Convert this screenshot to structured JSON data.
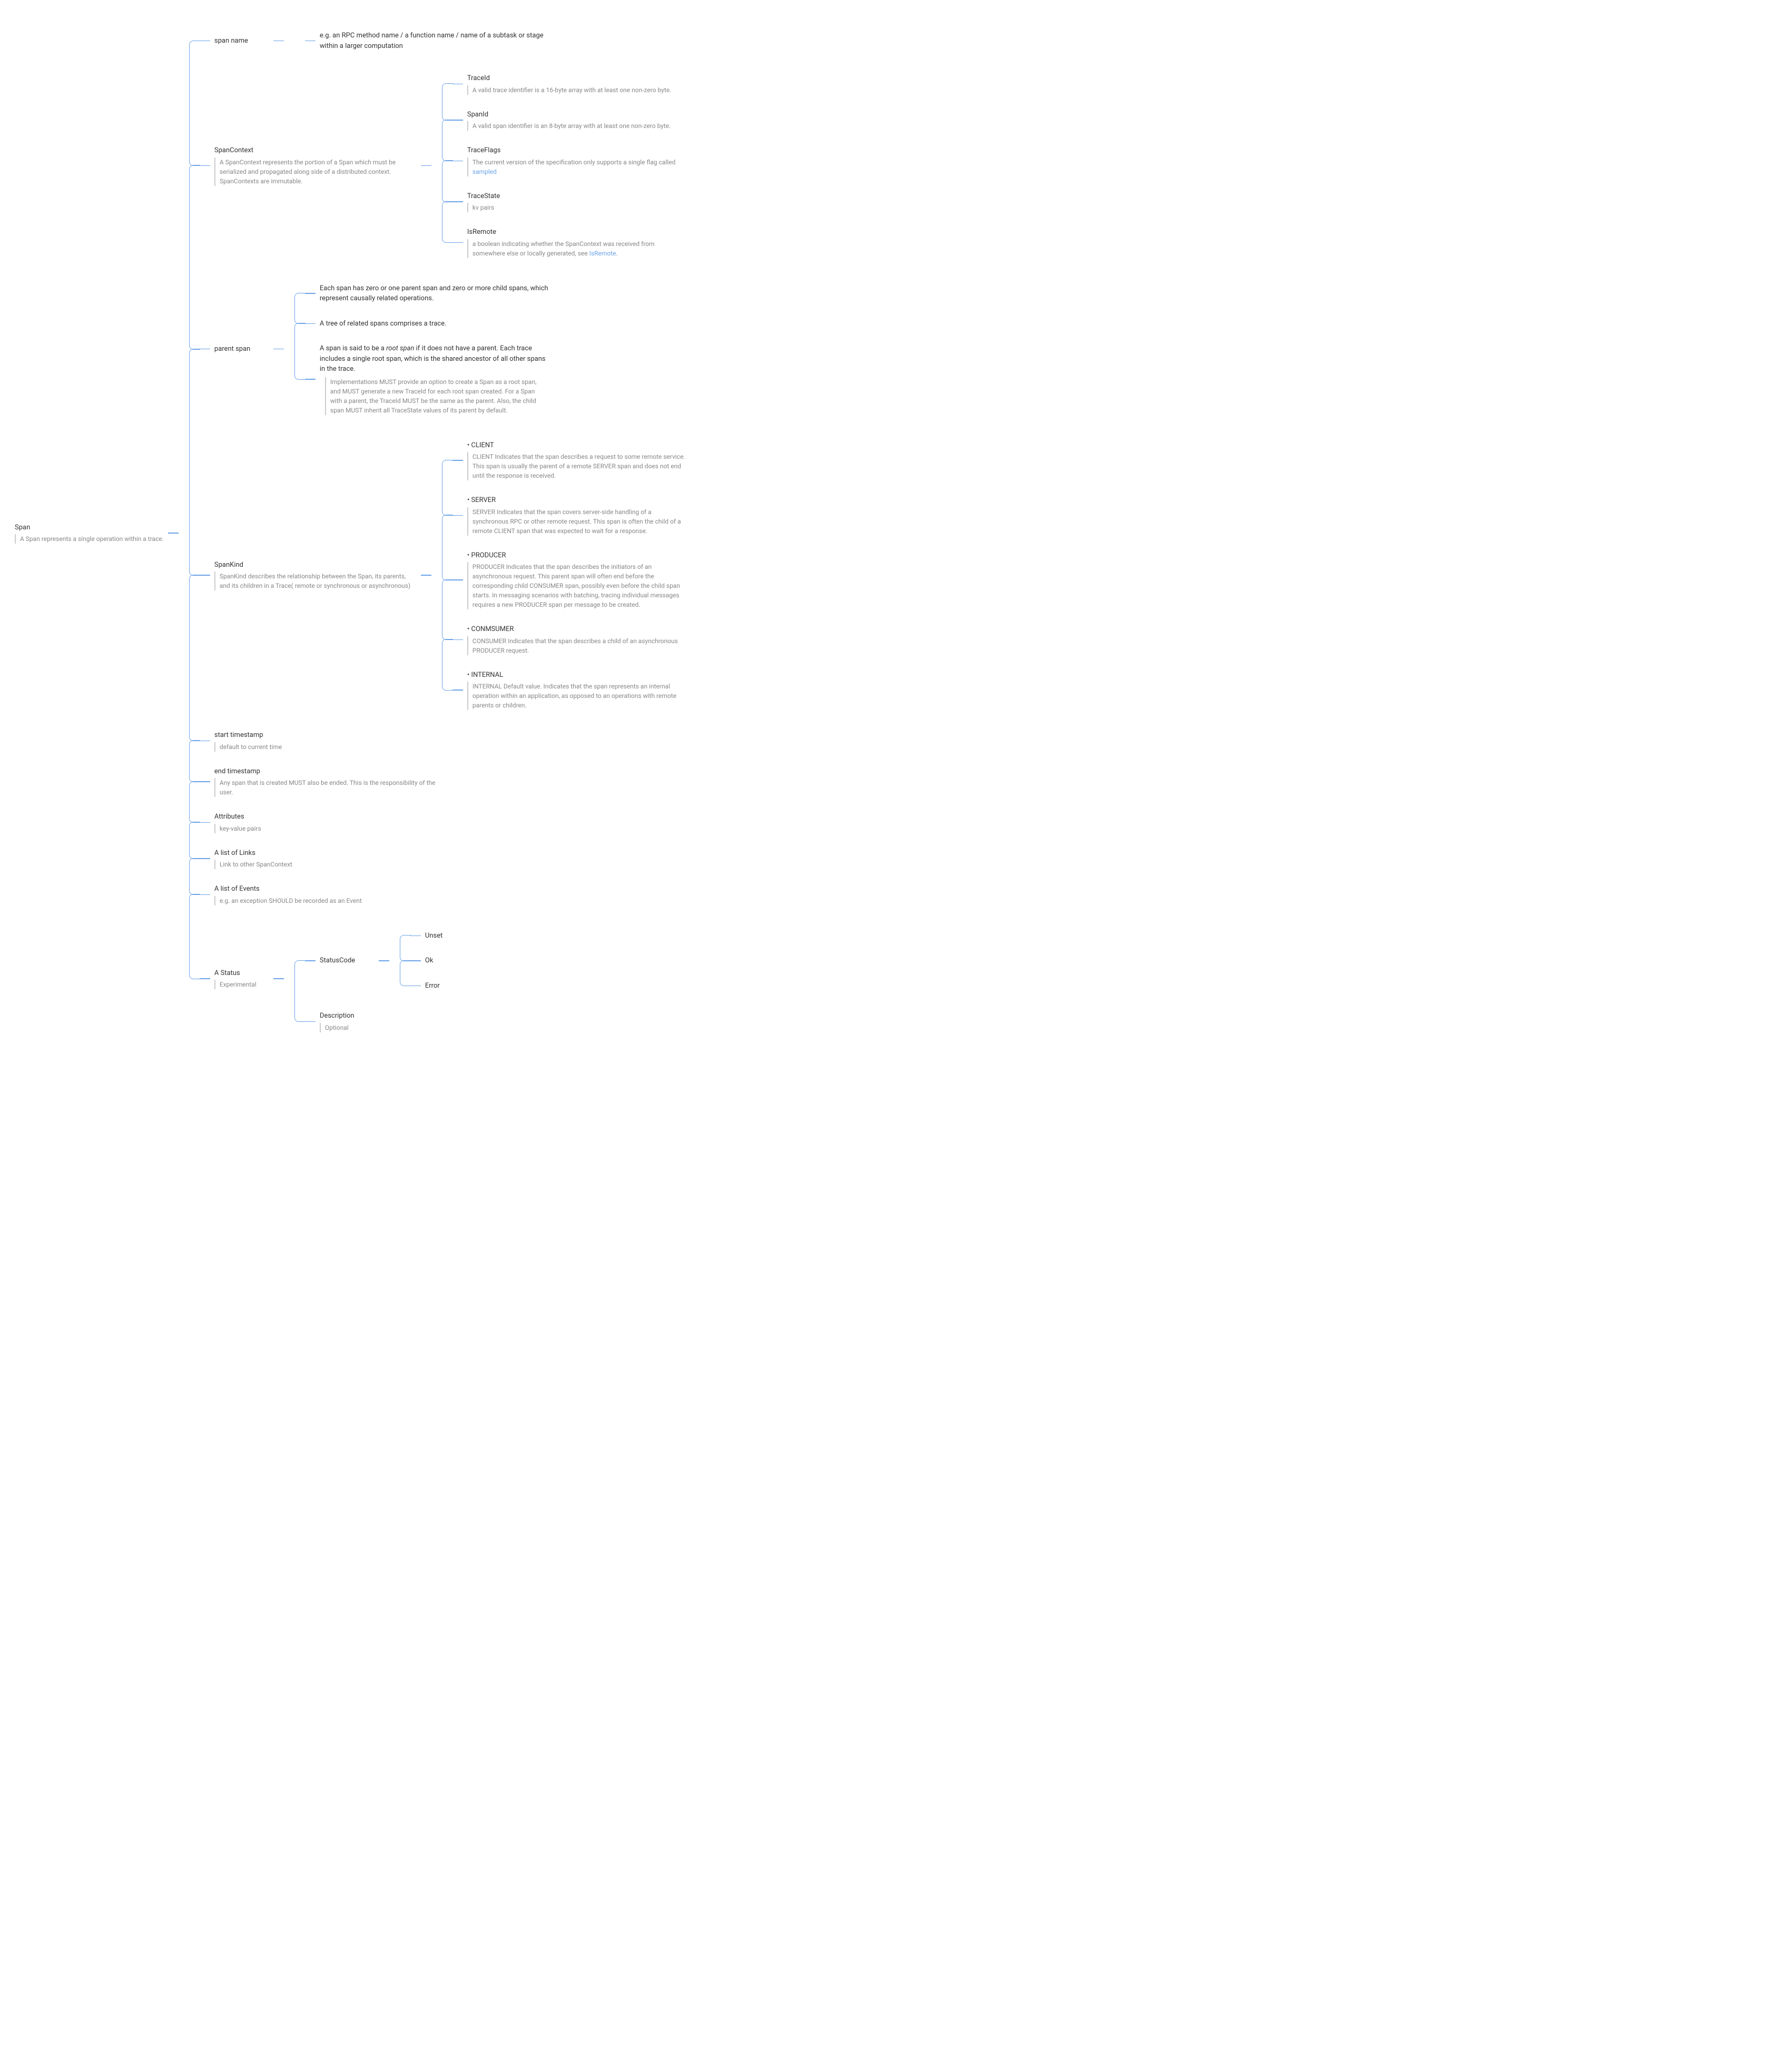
{
  "root": {
    "title": "Span",
    "desc": "A Span represents a single operation within a trace."
  },
  "span_name": {
    "title": "span name",
    "child": "e.g.  an RPC method name / a function name / name of a subtask or stage within a larger computation"
  },
  "span_context": {
    "title": "SpanContext",
    "desc": "A SpanContext represents the portion of a Span which must be serialized and propagated along side of a distributed context. SpanContexts are immutable.",
    "children": {
      "traceid": {
        "title": "TraceId",
        "desc": "A valid trace identifier is a 16-byte array with at least one non-zero byte."
      },
      "spanid": {
        "title": "SpanId",
        "desc": "A valid span identifier is an 8-byte array with at least one non-zero byte."
      },
      "traceflags": {
        "title": "TraceFlags",
        "desc_pre": "The current version of the specification only supports a single flag called ",
        "desc_link": "sampled"
      },
      "tracestate": {
        "title": "TraceState",
        "desc": "kv pairs"
      },
      "isremote": {
        "title": "IsRemote",
        "desc_pre": "a boolean indicating whether the SpanContext was received from somewhere else or locally generated, see ",
        "desc_link": "IsRemote",
        "desc_post": "."
      }
    }
  },
  "parent_span": {
    "title": "parent span",
    "c1": "Each span has zero or one parent span and zero or more child spans, which represent causally related operations.",
    "c2": "A tree of related spans comprises a trace.",
    "c3_pre": "A span is said to be a ",
    "c3_em": "root span",
    "c3_post": " if it does not have a parent. Each trace includes a single root span, which is the shared ancestor of all other spans in the trace.",
    "c3_sub": "Implementations MUST provide an option to create a Span as a root span, and MUST generate a new TraceId for each root span created. For a Span with a parent, the TraceId MUST be the same as the parent. Also, the child span MUST inherit all TraceState values of its parent by default."
  },
  "span_kind": {
    "title": "SpanKind",
    "desc": "SpanKind describes the relationship between the Span, its parents, and its children in a Trace( remote or  synchronous or asynchronous)",
    "client": {
      "title": "CLIENT",
      "desc": "CLIENT Indicates that the span describes a request to some remote service. This span is usually the parent of a remote SERVER span and does not end until the response is received."
    },
    "server": {
      "title": "SERVER",
      "desc": "SERVER Indicates that the span covers server-side handling of a synchronous RPC or other remote request. This span is often the child of a remote CLIENT span that was expected to wait for a response."
    },
    "producer": {
      "title": "PRODUCER",
      "desc": "PRODUCER Indicates that the span describes the initiators of an asynchronous request. This parent span will often end before the corresponding child CONSUMER span, possibly even before the child span starts. In messaging scenarios with batching, tracing individual messages requires a new PRODUCER span per message to be created."
    },
    "consumer": {
      "title": "CONMSUMER",
      "desc": "CONSUMER Indicates that the span describes a child of an asynchronous PRODUCER request."
    },
    "internal": {
      "title": "INTERNAL",
      "desc": "INTERNAL Default value. Indicates that the span represents an internal operation within an application, as opposed to an operations with remote parents or children."
    }
  },
  "start_ts": {
    "title": "start timestamp",
    "desc": "default to current time"
  },
  "end_ts": {
    "title": "end timestamp",
    "desc": "Any span that is created MUST also be ended. This is the responsibility of the user."
  },
  "attributes": {
    "title": "Attributes",
    "desc": "key-value pairs"
  },
  "links": {
    "title": "A list of Links",
    "desc": "Link to other SpanContext"
  },
  "events": {
    "title": "A list of Events",
    "desc": "e.g. an exception SHOULD be recorded as an Event"
  },
  "status": {
    "title": "A Status",
    "desc": "Experimental",
    "status_code": {
      "title": "StatusCode",
      "unset": "Unset",
      "ok": "Ok",
      "error": "Error"
    },
    "description": {
      "title": "Description",
      "desc": "Optional"
    }
  }
}
